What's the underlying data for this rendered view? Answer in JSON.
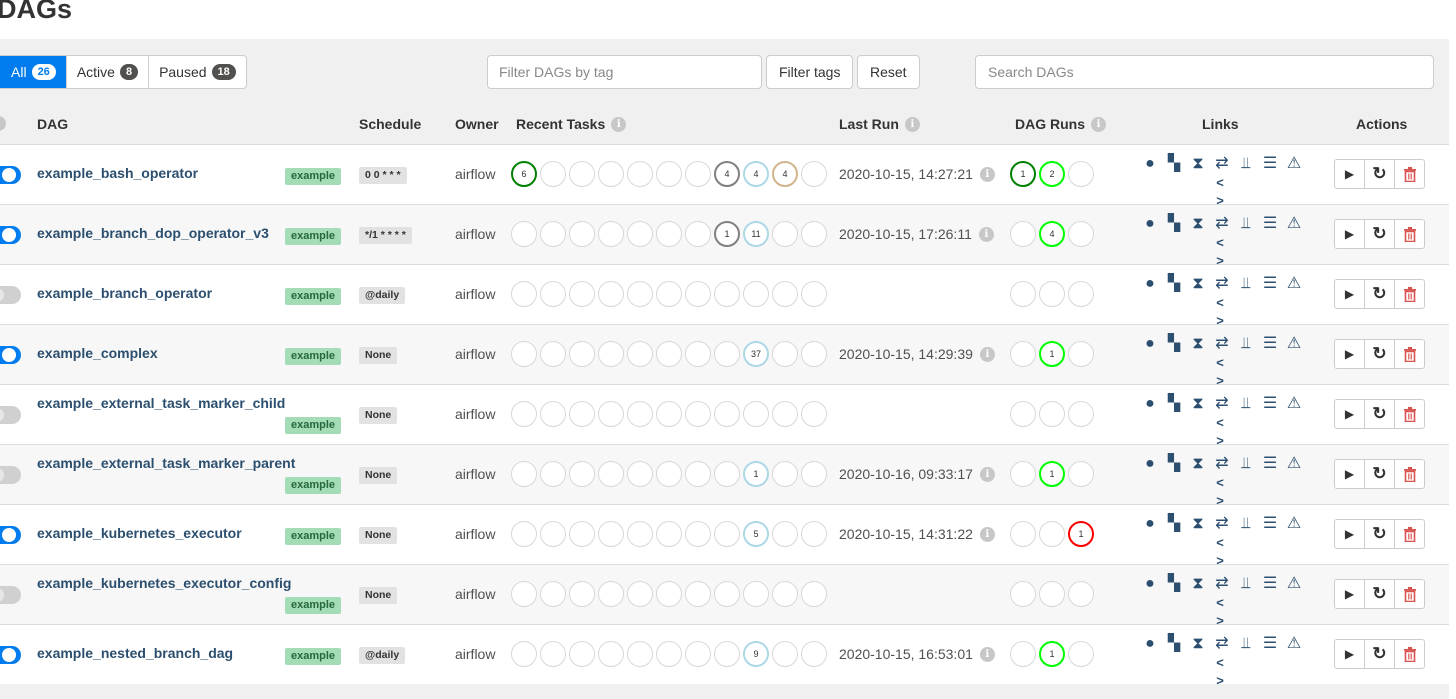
{
  "page": {
    "title": "DAGs"
  },
  "status_filter": [
    {
      "label": "All",
      "count": "26",
      "active": true
    },
    {
      "label": "Active",
      "count": "8",
      "active": false
    },
    {
      "label": "Paused",
      "count": "18",
      "active": false
    }
  ],
  "toolbar": {
    "tag_placeholder": "Filter DAGs by tag",
    "filter_tags_label": "Filter tags",
    "reset_label": "Reset",
    "search_placeholder": "Search DAGs"
  },
  "columns": {
    "dag": "DAG",
    "schedule": "Schedule",
    "owner": "Owner",
    "recent_tasks": "Recent Tasks",
    "last_run": "Last Run",
    "dag_runs": "DAG Runs",
    "links": "Links",
    "actions": "Actions",
    "info_icon": "i"
  },
  "colors": {
    "accent": "#017cee",
    "success": "#008000",
    "running": "#00ff00",
    "queued": "#808080",
    "up_for_retry": "#add8e6",
    "upstream_failed": "#d2b48c",
    "failed": "#ff0000",
    "empty": "#d8d8d8"
  },
  "link_icons": {
    "row1": [
      "●",
      "▚",
      "⧗",
      "⇄",
      "⫫",
      "☰",
      "⚠"
    ],
    "row1_names": [
      "tree-view-icon",
      "graph-view-icon",
      "duration-icon",
      "retries-icon",
      "landing-times-icon",
      "gantt-icon",
      "details-icon"
    ],
    "code": "< >"
  },
  "action_icons": {
    "trigger": "▶",
    "refresh": "↻",
    "delete": "Ὕ1"
  },
  "dags": [
    {
      "name": "example_bash_operator",
      "tag": "example",
      "schedule": "0 0 * * *",
      "owner": "airflow",
      "enabled": true,
      "name_two_line": false,
      "recent_tasks": [
        {
          "v": "6",
          "c": "success"
        },
        {
          "v": "",
          "c": "empty"
        },
        {
          "v": "",
          "c": "empty"
        },
        {
          "v": "",
          "c": "empty"
        },
        {
          "v": "",
          "c": "empty"
        },
        {
          "v": "",
          "c": "empty"
        },
        {
          "v": "",
          "c": "empty"
        },
        {
          "v": "4",
          "c": "queued"
        },
        {
          "v": "4",
          "c": "up_for_retry"
        },
        {
          "v": "4",
          "c": "upstream_failed"
        },
        {
          "v": "",
          "c": "empty"
        }
      ],
      "last_run": "2020-10-15, 14:27:21",
      "dag_runs": [
        {
          "v": "1",
          "c": "success"
        },
        {
          "v": "2",
          "c": "running"
        },
        {
          "v": "",
          "c": "empty"
        }
      ]
    },
    {
      "name": "example_branch_dop_operator_v3",
      "tag": "example",
      "schedule": "*/1 * * * *",
      "owner": "airflow",
      "enabled": true,
      "name_two_line": false,
      "recent_tasks": [
        {
          "v": "",
          "c": "empty"
        },
        {
          "v": "",
          "c": "empty"
        },
        {
          "v": "",
          "c": "empty"
        },
        {
          "v": "",
          "c": "empty"
        },
        {
          "v": "",
          "c": "empty"
        },
        {
          "v": "",
          "c": "empty"
        },
        {
          "v": "",
          "c": "empty"
        },
        {
          "v": "1",
          "c": "queued"
        },
        {
          "v": "11",
          "c": "up_for_retry"
        },
        {
          "v": "",
          "c": "empty"
        },
        {
          "v": "",
          "c": "empty"
        }
      ],
      "last_run": "2020-10-15, 17:26:11",
      "dag_runs": [
        {
          "v": "",
          "c": "empty"
        },
        {
          "v": "4",
          "c": "running"
        },
        {
          "v": "",
          "c": "empty"
        }
      ]
    },
    {
      "name": "example_branch_operator",
      "tag": "example",
      "schedule": "@daily",
      "owner": "airflow",
      "enabled": false,
      "name_two_line": false,
      "recent_tasks": [
        {
          "v": "",
          "c": "empty"
        },
        {
          "v": "",
          "c": "empty"
        },
        {
          "v": "",
          "c": "empty"
        },
        {
          "v": "",
          "c": "empty"
        },
        {
          "v": "",
          "c": "empty"
        },
        {
          "v": "",
          "c": "empty"
        },
        {
          "v": "",
          "c": "empty"
        },
        {
          "v": "",
          "c": "empty"
        },
        {
          "v": "",
          "c": "empty"
        },
        {
          "v": "",
          "c": "empty"
        },
        {
          "v": "",
          "c": "empty"
        }
      ],
      "last_run": "",
      "dag_runs": [
        {
          "v": "",
          "c": "empty"
        },
        {
          "v": "",
          "c": "empty"
        },
        {
          "v": "",
          "c": "empty"
        }
      ]
    },
    {
      "name": "example_complex",
      "tag": "example",
      "schedule": "None",
      "owner": "airflow",
      "enabled": true,
      "name_two_line": false,
      "recent_tasks": [
        {
          "v": "",
          "c": "empty"
        },
        {
          "v": "",
          "c": "empty"
        },
        {
          "v": "",
          "c": "empty"
        },
        {
          "v": "",
          "c": "empty"
        },
        {
          "v": "",
          "c": "empty"
        },
        {
          "v": "",
          "c": "empty"
        },
        {
          "v": "",
          "c": "empty"
        },
        {
          "v": "",
          "c": "empty"
        },
        {
          "v": "37",
          "c": "up_for_retry"
        },
        {
          "v": "",
          "c": "empty"
        },
        {
          "v": "",
          "c": "empty"
        }
      ],
      "last_run": "2020-10-15, 14:29:39",
      "dag_runs": [
        {
          "v": "",
          "c": "empty"
        },
        {
          "v": "1",
          "c": "running"
        },
        {
          "v": "",
          "c": "empty"
        }
      ]
    },
    {
      "name": "example_external_task_marker_child",
      "tag": "example",
      "schedule": "None",
      "owner": "airflow",
      "enabled": false,
      "name_two_line": true,
      "recent_tasks": [
        {
          "v": "",
          "c": "empty"
        },
        {
          "v": "",
          "c": "empty"
        },
        {
          "v": "",
          "c": "empty"
        },
        {
          "v": "",
          "c": "empty"
        },
        {
          "v": "",
          "c": "empty"
        },
        {
          "v": "",
          "c": "empty"
        },
        {
          "v": "",
          "c": "empty"
        },
        {
          "v": "",
          "c": "empty"
        },
        {
          "v": "",
          "c": "empty"
        },
        {
          "v": "",
          "c": "empty"
        },
        {
          "v": "",
          "c": "empty"
        }
      ],
      "last_run": "",
      "dag_runs": [
        {
          "v": "",
          "c": "empty"
        },
        {
          "v": "",
          "c": "empty"
        },
        {
          "v": "",
          "c": "empty"
        }
      ]
    },
    {
      "name": "example_external_task_marker_parent",
      "tag": "example",
      "schedule": "None",
      "owner": "airflow",
      "enabled": false,
      "name_two_line": true,
      "recent_tasks": [
        {
          "v": "",
          "c": "empty"
        },
        {
          "v": "",
          "c": "empty"
        },
        {
          "v": "",
          "c": "empty"
        },
        {
          "v": "",
          "c": "empty"
        },
        {
          "v": "",
          "c": "empty"
        },
        {
          "v": "",
          "c": "empty"
        },
        {
          "v": "",
          "c": "empty"
        },
        {
          "v": "",
          "c": "empty"
        },
        {
          "v": "1",
          "c": "up_for_retry"
        },
        {
          "v": "",
          "c": "empty"
        },
        {
          "v": "",
          "c": "empty"
        }
      ],
      "last_run": "2020-10-16, 09:33:17",
      "dag_runs": [
        {
          "v": "",
          "c": "empty"
        },
        {
          "v": "1",
          "c": "running"
        },
        {
          "v": "",
          "c": "empty"
        }
      ]
    },
    {
      "name": "example_kubernetes_executor",
      "tag": "example",
      "schedule": "None",
      "owner": "airflow",
      "enabled": true,
      "name_two_line": false,
      "recent_tasks": [
        {
          "v": "",
          "c": "empty"
        },
        {
          "v": "",
          "c": "empty"
        },
        {
          "v": "",
          "c": "empty"
        },
        {
          "v": "",
          "c": "empty"
        },
        {
          "v": "",
          "c": "empty"
        },
        {
          "v": "",
          "c": "empty"
        },
        {
          "v": "",
          "c": "empty"
        },
        {
          "v": "",
          "c": "empty"
        },
        {
          "v": "5",
          "c": "up_for_retry"
        },
        {
          "v": "",
          "c": "empty"
        },
        {
          "v": "",
          "c": "empty"
        }
      ],
      "last_run": "2020-10-15, 14:31:22",
      "dag_runs": [
        {
          "v": "",
          "c": "empty"
        },
        {
          "v": "",
          "c": "empty"
        },
        {
          "v": "1",
          "c": "failed"
        }
      ]
    },
    {
      "name": "example_kubernetes_executor_config",
      "tag": "example",
      "schedule": "None",
      "owner": "airflow",
      "enabled": false,
      "name_two_line": true,
      "recent_tasks": [
        {
          "v": "",
          "c": "empty"
        },
        {
          "v": "",
          "c": "empty"
        },
        {
          "v": "",
          "c": "empty"
        },
        {
          "v": "",
          "c": "empty"
        },
        {
          "v": "",
          "c": "empty"
        },
        {
          "v": "",
          "c": "empty"
        },
        {
          "v": "",
          "c": "empty"
        },
        {
          "v": "",
          "c": "empty"
        },
        {
          "v": "",
          "c": "empty"
        },
        {
          "v": "",
          "c": "empty"
        },
        {
          "v": "",
          "c": "empty"
        }
      ],
      "last_run": "",
      "dag_runs": [
        {
          "v": "",
          "c": "empty"
        },
        {
          "v": "",
          "c": "empty"
        },
        {
          "v": "",
          "c": "empty"
        }
      ]
    },
    {
      "name": "example_nested_branch_dag",
      "tag": "example",
      "schedule": "@daily",
      "owner": "airflow",
      "enabled": true,
      "name_two_line": false,
      "recent_tasks": [
        {
          "v": "",
          "c": "empty"
        },
        {
          "v": "",
          "c": "empty"
        },
        {
          "v": "",
          "c": "empty"
        },
        {
          "v": "",
          "c": "empty"
        },
        {
          "v": "",
          "c": "empty"
        },
        {
          "v": "",
          "c": "empty"
        },
        {
          "v": "",
          "c": "empty"
        },
        {
          "v": "",
          "c": "empty"
        },
        {
          "v": "9",
          "c": "up_for_retry"
        },
        {
          "v": "",
          "c": "empty"
        },
        {
          "v": "",
          "c": "empty"
        }
      ],
      "last_run": "2020-10-15, 16:53:01",
      "dag_runs": [
        {
          "v": "",
          "c": "empty"
        },
        {
          "v": "1",
          "c": "running"
        },
        {
          "v": "",
          "c": "empty"
        }
      ]
    }
  ]
}
